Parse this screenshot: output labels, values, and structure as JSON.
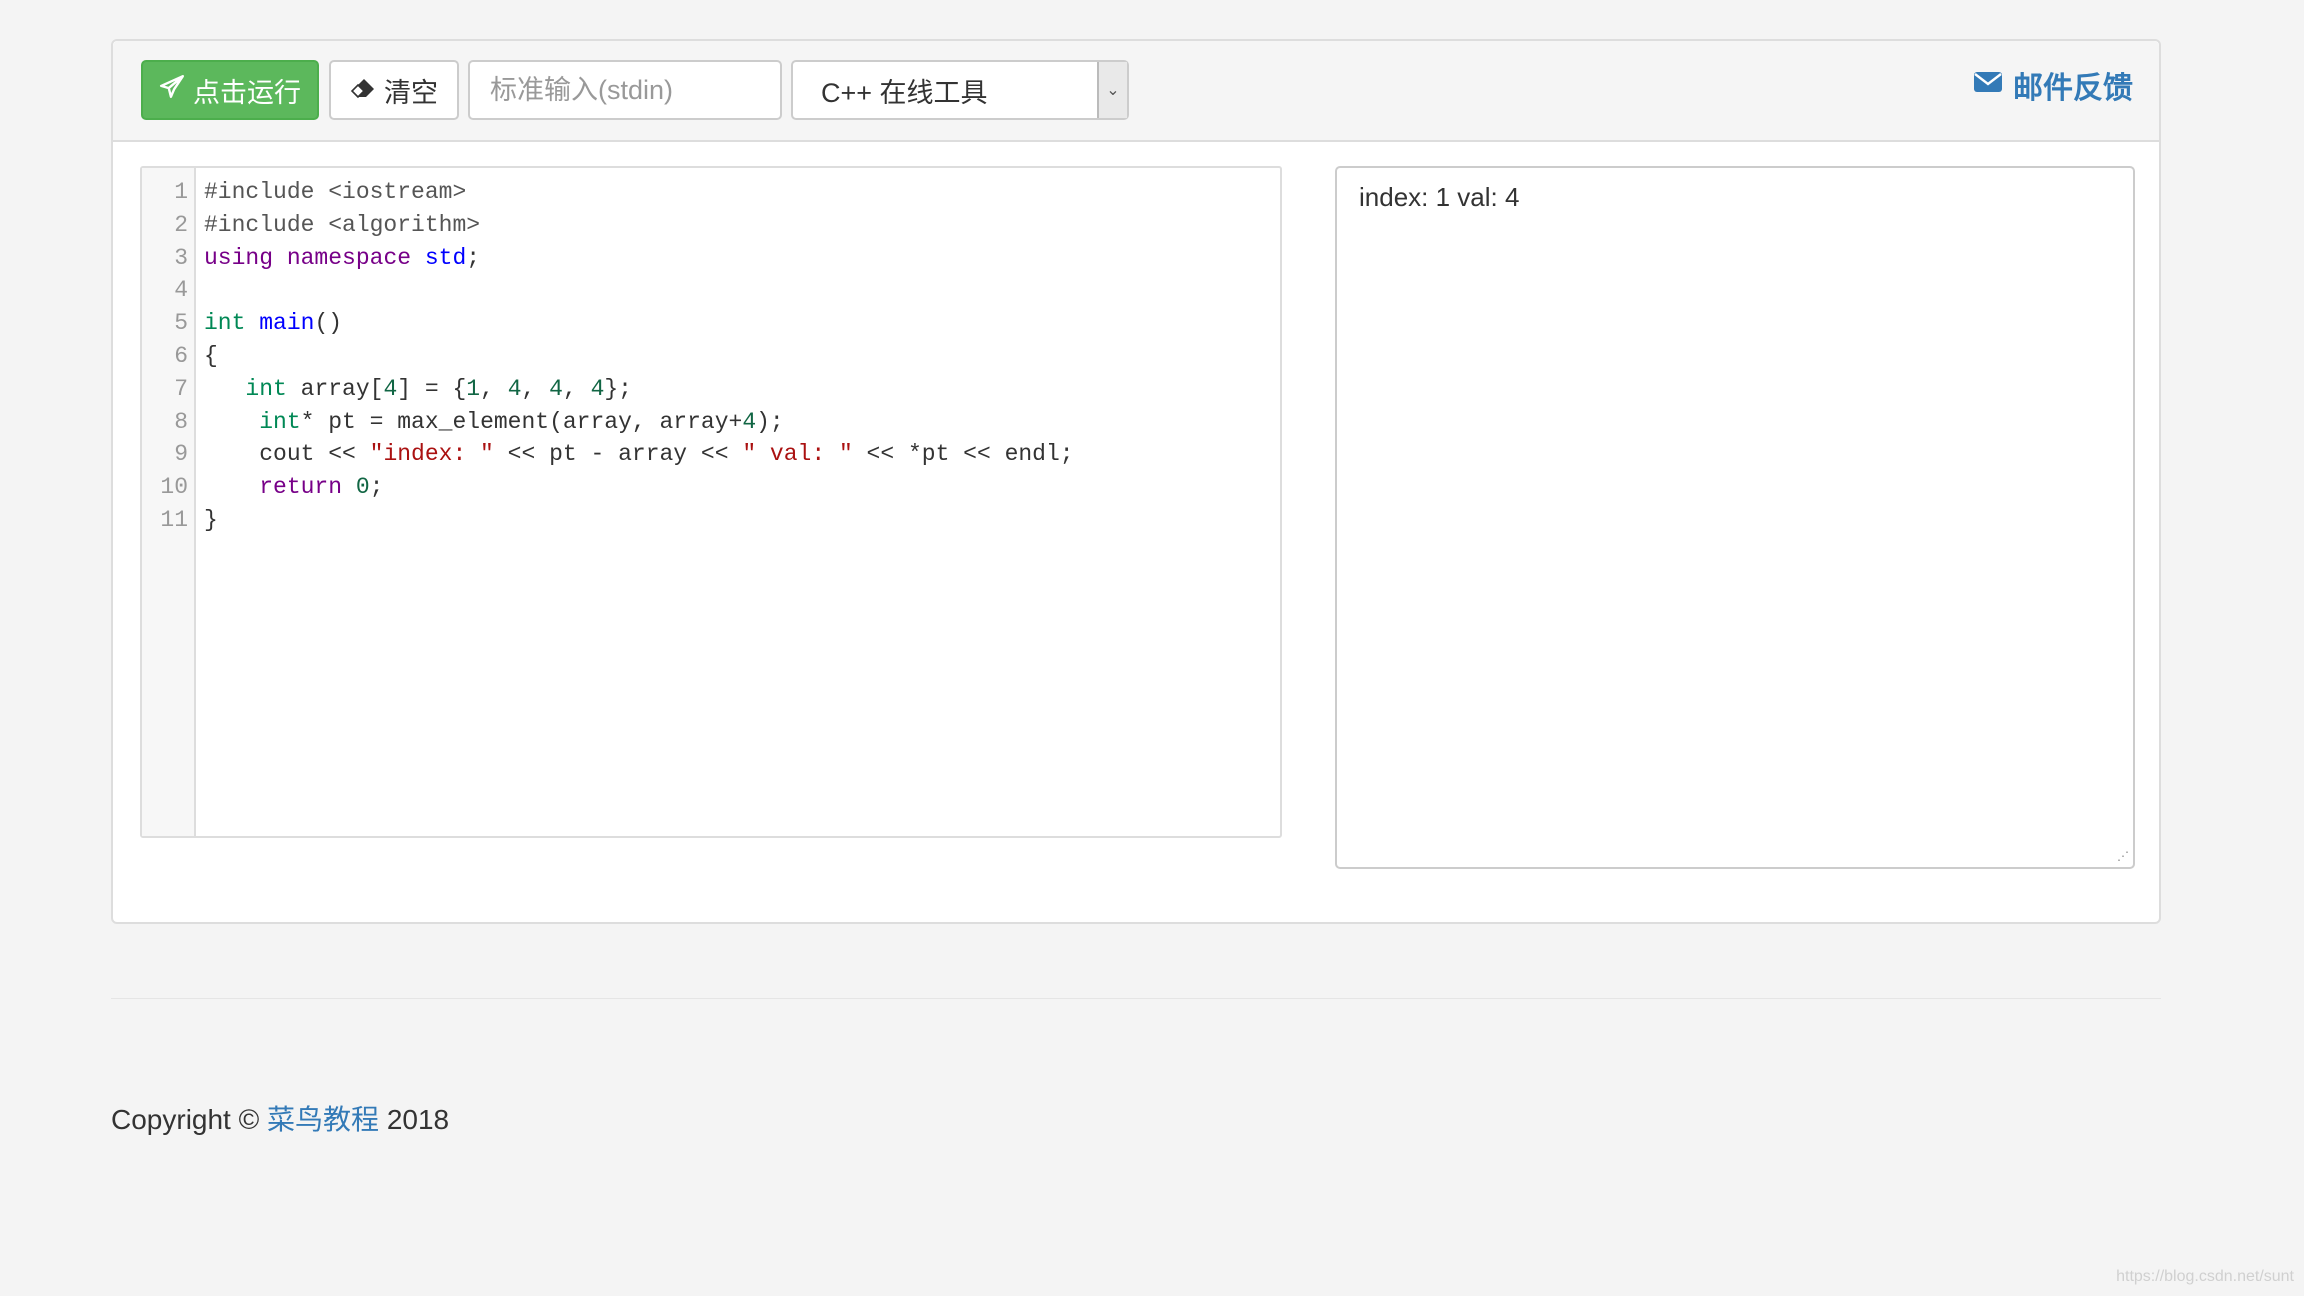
{
  "toolbar": {
    "run_label": "点击运行",
    "clear_label": "清空",
    "stdin_placeholder": "标准输入(stdin)",
    "language_selected": "C++ 在线工具",
    "feedback_label": "邮件反馈"
  },
  "editor": {
    "line_numbers": [
      "1",
      "2",
      "3",
      "4",
      "5",
      "6",
      "7",
      "8",
      "9",
      "10",
      "11"
    ]
  },
  "output": {
    "text": "index: 1 val: 4"
  },
  "footer": {
    "copyright_prefix": "Copyright © ",
    "site_name": "菜鸟教程",
    "year": " 2018"
  },
  "watermark": "https://blog.csdn.net/sunt",
  "colors": {
    "run_button": "#5cb85c",
    "link": "#337ab7"
  },
  "icons": {
    "run": "paper-plane-icon",
    "clear": "eraser-icon",
    "feedback": "envelope-icon"
  }
}
